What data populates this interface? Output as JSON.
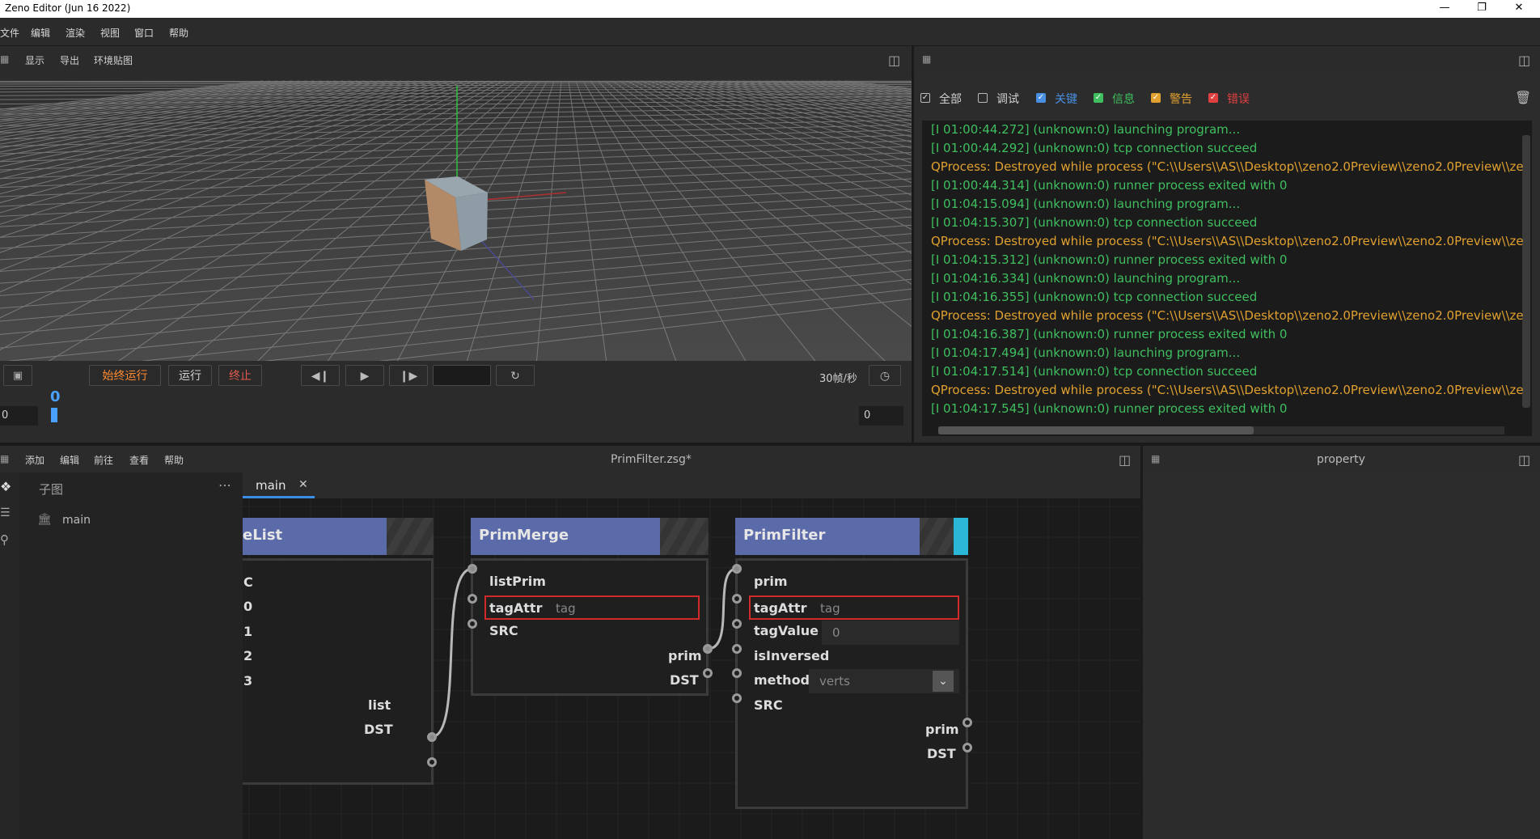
{
  "window": {
    "title": "Zeno Editor (Jun 16 2022)"
  },
  "menu": [
    "文件",
    "编辑",
    "渲染",
    "视图",
    "窗口",
    "帮助"
  ],
  "viewport": {
    "toolbar": [
      "显示",
      "导出",
      "环境贴图"
    ],
    "controls": {
      "always_run": "始终运行",
      "run": "运行",
      "stop": "终止",
      "fps": "30帧/秒"
    },
    "timeline": {
      "start": "0",
      "current": "0",
      "end": "0"
    },
    "colors": {
      "grid_bg": "#3c3c3c",
      "stop": "#e05a4e",
      "always_run": "#ff8a30"
    }
  },
  "log": {
    "filters": [
      {
        "label": "全部",
        "checked": true,
        "color": "#d0d0d0"
      },
      {
        "label": "调试",
        "checked": false,
        "color": "#d0d0d0"
      },
      {
        "label": "关键",
        "checked": true,
        "color": "#4a90e2"
      },
      {
        "label": "信息",
        "checked": true,
        "color": "#3fbf5f"
      },
      {
        "label": "警告",
        "checked": true,
        "color": "#e0a030"
      },
      {
        "label": "错误",
        "checked": true,
        "color": "#e04040"
      }
    ],
    "lines": [
      {
        "text": "[I 01:00:44.272] (unknown:0) launching program...",
        "level": "info"
      },
      {
        "text": "[I 01:00:44.292] (unknown:0) tcp connection succeed",
        "level": "info"
      },
      {
        "text": "QProcess: Destroyed while process (\"C:\\\\Users\\\\AS\\\\Desktop\\\\zeno2.0Preview\\\\zeno2.0Preview\\\\zenoe",
        "level": "warn"
      },
      {
        "text": "[I 01:00:44.314] (unknown:0) runner process exited with 0",
        "level": "info"
      },
      {
        "text": "[I 01:04:15.094] (unknown:0) launching program...",
        "level": "info"
      },
      {
        "text": "[I 01:04:15.307] (unknown:0) tcp connection succeed",
        "level": "info"
      },
      {
        "text": "QProcess: Destroyed while process (\"C:\\\\Users\\\\AS\\\\Desktop\\\\zeno2.0Preview\\\\zeno2.0Preview\\\\zenoe",
        "level": "warn"
      },
      {
        "text": "[I 01:04:15.312] (unknown:0) runner process exited with 0",
        "level": "info"
      },
      {
        "text": "[I 01:04:16.334] (unknown:0) launching program...",
        "level": "info"
      },
      {
        "text": "[I 01:04:16.355] (unknown:0) tcp connection succeed",
        "level": "info"
      },
      {
        "text": "QProcess: Destroyed while process (\"C:\\\\Users\\\\AS\\\\Desktop\\\\zeno2.0Preview\\\\zeno2.0Preview\\\\zenoe",
        "level": "warn"
      },
      {
        "text": "[I 01:04:16.387] (unknown:0) runner process exited with 0",
        "level": "info"
      },
      {
        "text": "[I 01:04:17.494] (unknown:0) launching program...",
        "level": "info"
      },
      {
        "text": "[I 01:04:17.514] (unknown:0) tcp connection succeed",
        "level": "info"
      },
      {
        "text": "QProcess: Destroyed while process (\"C:\\\\Users\\\\AS\\\\Desktop\\\\zeno2.0Preview\\\\zeno2.0Preview\\\\zenoe",
        "level": "warn"
      },
      {
        "text": "[I 01:04:17.545] (unknown:0) runner process exited with 0",
        "level": "info"
      }
    ],
    "colors": {
      "info": "#3fbf5f",
      "warn": "#e0a030"
    }
  },
  "editor": {
    "menu": [
      "添加",
      "编辑",
      "前往",
      "查看",
      "帮助"
    ],
    "file_title": "PrimFilter.zsg*",
    "subgraph_header": "子图",
    "subgraphs": [
      "main"
    ],
    "tab": "main",
    "nodes": {
      "makelist": {
        "title": "eList",
        "inputs": [
          "C",
          "0",
          "1",
          "2",
          "3"
        ],
        "outputs": [
          "list",
          "DST"
        ]
      },
      "primmerge": {
        "title": "PrimMerge",
        "inputs": [
          "listPrim",
          "tagAttr",
          "SRC"
        ],
        "tagAttr_value": "tag",
        "outputs": [
          "prim",
          "DST"
        ]
      },
      "primfilter": {
        "title": "PrimFilter",
        "inputs": [
          "prim",
          "tagAttr",
          "tagValue",
          "isInversed",
          "method",
          "SRC"
        ],
        "tagAttr_value": "tag",
        "tagValue_value": "0",
        "method_value": "verts",
        "outputs": [
          "prim",
          "DST"
        ]
      }
    }
  },
  "property": {
    "title": "property"
  }
}
